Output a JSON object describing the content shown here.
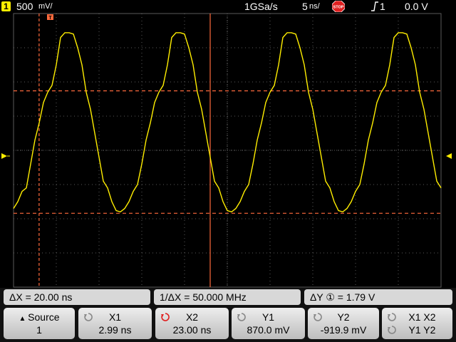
{
  "status_bar": {
    "channel_number": "1",
    "vertical_scale": "500",
    "vertical_unit": "mV/",
    "sample_rate": "1GSa/s",
    "timebase": "5",
    "timebase_unit": "ns/",
    "run_state_icon": "stop-icon",
    "run_state_label": "STOP",
    "trigger_icon": "rising-edge-trigger-icon",
    "trigger_source": "1",
    "trigger_level": "0.0 V"
  },
  "display": {
    "background": "#000000",
    "grid_color": "#5a5a5a",
    "trace_color": "#ffee00",
    "cursor_color": "#ff6a3c",
    "graticule_divisions": {
      "x": 10,
      "y": 8
    },
    "trigger_marker_icon": "trigger-marker-icon",
    "ground_marker_icon": "channel1-ground-icon",
    "trigger_level_marker_icon": "trigger-level-arrow-icon"
  },
  "chart_data": {
    "type": "line",
    "title": "",
    "xlabel": "",
    "ylabel": "",
    "x_units": "ns",
    "y_units": "V",
    "xlim": [
      0,
      50
    ],
    "ylim": [
      -2,
      2
    ],
    "grid": true,
    "series": [
      {
        "color": "#ffee00",
        "x": [
          0,
          0.5,
          1,
          1.5,
          2,
          2.5,
          3,
          3.5,
          4,
          4.5,
          5,
          5.5,
          6,
          6.5,
          7,
          7.5,
          8,
          8.5,
          9,
          9.5,
          10,
          10.5,
          11,
          11.5,
          12,
          12.5,
          13,
          13.5,
          14,
          14.5,
          15,
          15.5,
          16,
          16.5,
          17,
          17.5,
          18,
          18.5,
          19,
          19.5,
          20,
          20.5,
          21,
          21.5,
          22,
          22.5,
          23,
          23.5,
          24,
          24.5,
          25,
          25.5,
          26,
          26.5,
          27,
          27.5,
          28,
          28.5,
          29,
          29.5,
          30,
          30.5,
          31,
          31.5,
          32,
          32.5,
          33,
          33.5,
          34,
          34.5,
          35,
          35.5,
          36,
          36.5,
          37,
          37.5,
          38,
          38.5,
          39,
          39.5,
          40,
          40.5,
          41,
          41.5,
          42,
          42.5,
          43,
          43.5,
          44,
          44.5,
          45,
          45.5,
          46,
          46.5,
          47,
          47.5,
          48,
          48.5,
          49,
          49.5,
          50
        ],
        "values": [
          -0.85,
          -0.75,
          -0.6,
          -0.55,
          -0.2,
          0.15,
          0.4,
          0.7,
          0.85,
          0.95,
          1.25,
          1.65,
          1.72,
          1.72,
          1.7,
          1.5,
          1.25,
          0.85,
          0.6,
          0.25,
          -0.1,
          -0.45,
          -0.55,
          -0.75,
          -0.88,
          -0.9,
          -0.85,
          -0.75,
          -0.6,
          -0.5,
          -0.2,
          0.15,
          0.4,
          0.7,
          0.85,
          0.95,
          1.25,
          1.65,
          1.72,
          1.72,
          1.7,
          1.5,
          1.25,
          0.85,
          0.6,
          0.25,
          -0.1,
          -0.45,
          -0.55,
          -0.75,
          -0.88,
          -0.9,
          -0.85,
          -0.75,
          -0.6,
          -0.5,
          -0.2,
          0.15,
          0.4,
          0.7,
          0.85,
          0.95,
          1.25,
          1.65,
          1.72,
          1.72,
          1.7,
          1.5,
          1.25,
          0.85,
          0.6,
          0.25,
          -0.1,
          -0.45,
          -0.55,
          -0.75,
          -0.88,
          -0.9,
          -0.85,
          -0.75,
          -0.6,
          -0.5,
          -0.2,
          0.15,
          0.4,
          0.7,
          0.85,
          0.95,
          1.25,
          1.65,
          1.72,
          1.72,
          1.7,
          1.5,
          1.25,
          0.85,
          0.6,
          0.25,
          -0.1,
          -0.45,
          -0.55
        ]
      }
    ],
    "cursors": {
      "x1": 2.99,
      "x2": 23.0,
      "y1": 0.87,
      "y2": -0.9199
    }
  },
  "measurements": {
    "delta_x": "ΔX = 20.00 ns",
    "inverse_delta_x": "1/ΔX = 50.000 MHz",
    "delta_y": "ΔY ① =  1.79  V"
  },
  "softkeys": [
    {
      "name": "source",
      "line1": "Source",
      "line2": "1",
      "icon": "up-triangle-icon"
    },
    {
      "name": "x1",
      "line1": "X1",
      "line2": "2.99 ns",
      "icon": "knob-icon",
      "knob_color": "#888888"
    },
    {
      "name": "x2",
      "line1": "X2",
      "line2": "23.00 ns",
      "icon": "knob-icon",
      "knob_color": "#e02020"
    },
    {
      "name": "y1",
      "line1": "Y1",
      "line2": "870.0 mV",
      "icon": "knob-icon",
      "knob_color": "#888888"
    },
    {
      "name": "y2",
      "line1": "Y2",
      "line2": "-919.9 mV",
      "icon": "knob-icon",
      "knob_color": "#888888"
    },
    {
      "name": "x1x2-y1y2",
      "line1": "X1 X2",
      "line2": "Y1 Y2",
      "icon": "knob-icon",
      "knob_color": "#888888"
    }
  ]
}
